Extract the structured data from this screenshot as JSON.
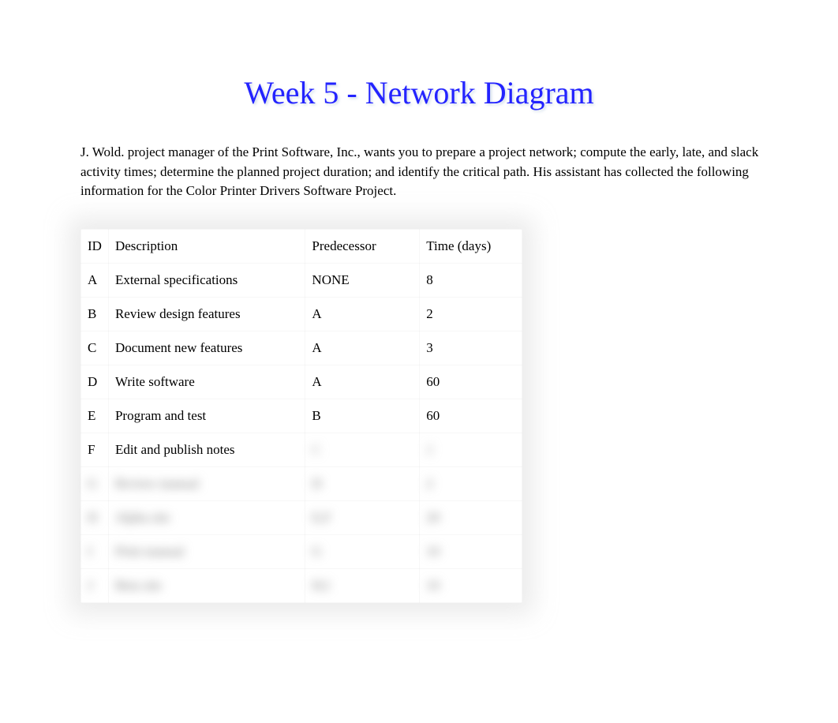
{
  "title": "Week 5 - Network Diagram",
  "intro": "J. Wold. project manager of the Print Software, Inc., wants you to prepare a project network; compute the early, late, and slack activity times; determine the planned project duration; and identify the critical path. His assistant has collected the following information for the Color Printer Drivers Software Project.",
  "table": {
    "headers": {
      "id": "ID",
      "description": "Description",
      "predecessor": "Predecessor",
      "time": "Time (days)"
    },
    "rows": [
      {
        "id": "A",
        "description": "External specifications",
        "predecessor": "NONE",
        "time": "8",
        "blurred": false
      },
      {
        "id": "B",
        "description": "Review design features",
        "predecessor": "A",
        "time": "2",
        "blurred": false
      },
      {
        "id": "C",
        "description": "Document new features",
        "predecessor": "A",
        "time": "3",
        "blurred": false
      },
      {
        "id": "D",
        "description": "Write software",
        "predecessor": "A",
        "time": "60",
        "blurred": false
      },
      {
        "id": "E",
        "description": "Program and test",
        "predecessor": "B",
        "time": "60",
        "blurred": false
      },
      {
        "id": "F",
        "description": "Edit and publish notes",
        "predecessor": "C",
        "time": "2",
        "blurred": false,
        "partial_blur": true
      },
      {
        "id": "G",
        "description": "Review manual",
        "predecessor": "D",
        "time": "2",
        "blurred": true
      },
      {
        "id": "H",
        "description": "Alpha site",
        "predecessor": "E,F",
        "time": "20",
        "blurred": true
      },
      {
        "id": "I",
        "description": "Print manual",
        "predecessor": "G",
        "time": "10",
        "blurred": true
      },
      {
        "id": "J",
        "description": "Beta site",
        "predecessor": "H,I",
        "time": "10",
        "blurred": true
      }
    ]
  }
}
